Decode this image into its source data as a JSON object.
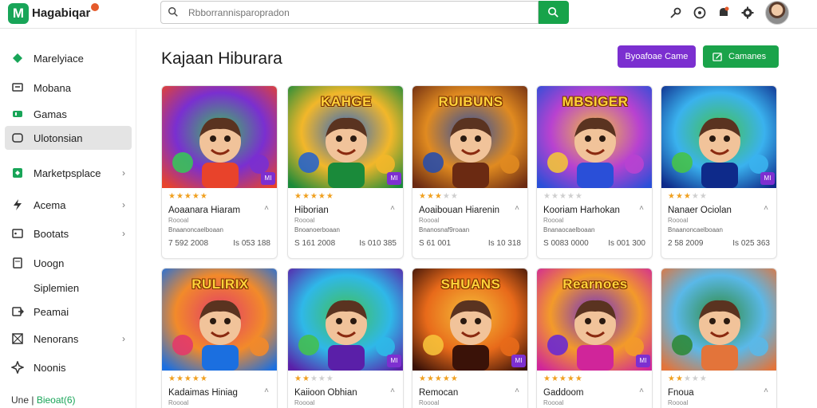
{
  "header": {
    "logo_letter": "M",
    "brand": "Hagabiqar",
    "search_placeholder": "Rbborrannisparopradon"
  },
  "sidebar": {
    "items": [
      {
        "label": "Marelyiace"
      },
      {
        "label": "Mobana"
      },
      {
        "label": "Gamas"
      },
      {
        "label": "Ulotonsian"
      },
      {
        "label": "Marketpsplace"
      },
      {
        "label": "Acema"
      },
      {
        "label": "Bootats"
      },
      {
        "label": "Uoogn"
      },
      {
        "label": "Siplemien"
      },
      {
        "label": "Peamai"
      },
      {
        "label": "Nenorans"
      },
      {
        "label": "Noonis"
      }
    ],
    "footer_prefix": "Une |",
    "footer_highlight": "Bieoat(6)"
  },
  "main": {
    "title": "Kajaan Hiburara",
    "btn_primary": "Byoafoae Came",
    "btn_secondary": "Camanes"
  },
  "cards": [
    {
      "name": "Aoaanara Hiaram",
      "sub": "Roooal",
      "meta": "Bnaanoncaelboaan",
      "left": "7 592 2008",
      "right": "Is 053 188",
      "thumb_title": "",
      "badge": "MI"
    },
    {
      "name": "Hiborian",
      "sub": "Roooal",
      "meta": "Bnoanoerboaan",
      "left": "S 161 2008",
      "right": "Is 010 385",
      "thumb_title": "KAHGE",
      "badge": "MI"
    },
    {
      "name": "Aoaibouan Hiarenin",
      "sub": "Roooal",
      "meta": "Bnanosnaf9roaan",
      "left": "S 61 001",
      "right": "Is 10 318",
      "thumb_title": "RUIBUNS",
      "badge": ""
    },
    {
      "name": "Kooriam Harhokan",
      "sub": "Roooal",
      "meta": "Bnanaocaelboaan",
      "left": "S 0083 0000",
      "right": "Is 001 300",
      "thumb_title": "MBSIGER",
      "badge": ""
    },
    {
      "name": "Nanaer Ociolan",
      "sub": "Roooal",
      "meta": "Bnaanoncaelboaan",
      "left": "2 58 2009",
      "right": "Is 025 363",
      "thumb_title": "",
      "badge": "MI"
    },
    {
      "name": "Kadaimas Hiniag",
      "sub": "Roooal",
      "meta": "",
      "left": "",
      "right": "",
      "thumb_title": "RULIRIX",
      "badge": ""
    },
    {
      "name": "Kaiioon Obhian",
      "sub": "Roooal",
      "meta": "",
      "left": "",
      "right": "",
      "thumb_title": "",
      "badge": "MI"
    },
    {
      "name": "Remocan",
      "sub": "Roooal",
      "meta": "",
      "left": "",
      "right": "",
      "thumb_title": "SHUANS",
      "badge": "MI"
    },
    {
      "name": "Gaddoom",
      "sub": "Roooal",
      "meta": "",
      "left": "",
      "right": "",
      "thumb_title": "Rearnoes",
      "badge": "MI"
    },
    {
      "name": "Fnoua",
      "sub": "Roooal",
      "meta": "",
      "left": "",
      "right": "",
      "thumb_title": "",
      "badge": ""
    }
  ],
  "ratings": [
    5,
    5,
    3,
    0,
    3,
    5,
    2,
    5,
    5,
    2
  ],
  "colors": {
    "accent_green": "#18a558",
    "accent_purple": "#7b2fd0",
    "star": "#f0a020"
  },
  "icons": [
    "search-icon",
    "key-icon",
    "clock-icon",
    "bell-icon",
    "gear-icon",
    "cart-icon"
  ]
}
